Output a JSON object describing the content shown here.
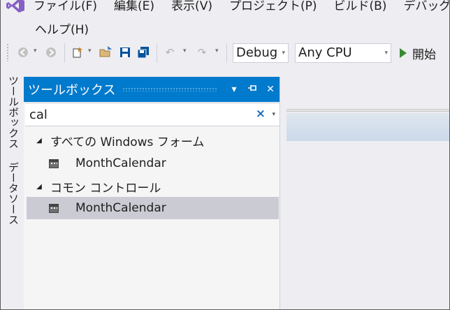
{
  "menu": {
    "items": [
      "ファイル(F)",
      "編集(E)",
      "表示(V)",
      "プロジェクト(P)",
      "ビルド(B)",
      "デバッグ(D)"
    ],
    "help": "ヘルプ(H)"
  },
  "toolbar": {
    "configuration": "Debug",
    "platform": "Any CPU",
    "start_label": "開始"
  },
  "side_tabs": {
    "toolbox": "ツールボックス",
    "data_sources": "データソース"
  },
  "toolbox": {
    "title": "ツールボックス",
    "search_value": "cal",
    "groups": [
      {
        "label": "すべての Windows フォーム",
        "items": [
          "MonthCalendar"
        ]
      },
      {
        "label": "コモン コントロール",
        "items": [
          "MonthCalendar"
        ]
      }
    ]
  },
  "colors": {
    "accent": "#007acc",
    "selection": "#cacbd3",
    "start_green": "#388a34",
    "logo": "#865fc5"
  }
}
